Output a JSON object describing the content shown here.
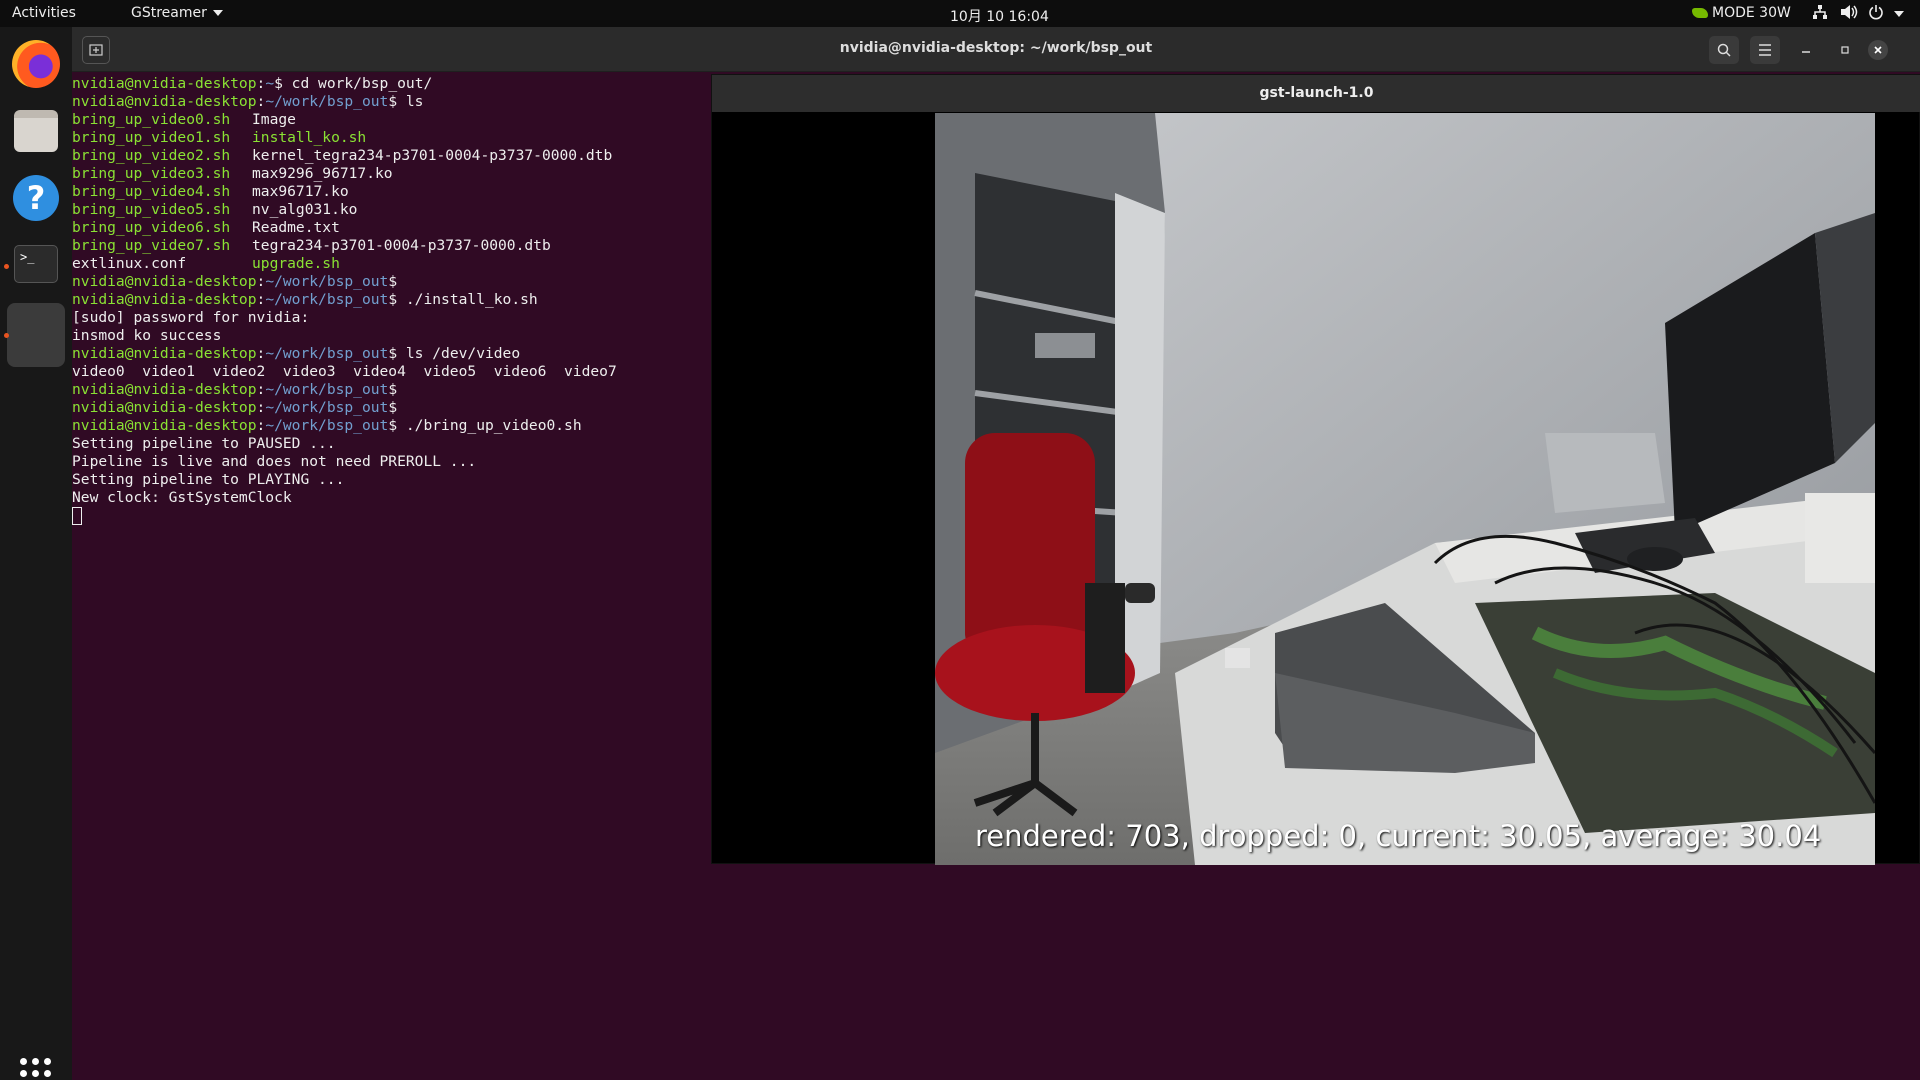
{
  "topbar": {
    "activities": "Activities",
    "app_menu": "GStreamer",
    "clock": "10月 10  16:04",
    "mode": "MODE 30W",
    "network_icon": "network-icon",
    "volume_icon": "volume-icon",
    "power_icon": "power-icon"
  },
  "dock": {
    "items": [
      "firefox",
      "files",
      "help",
      "terminal",
      "gst-launch"
    ],
    "show_apps_icon": "grid-icon"
  },
  "terminal": {
    "title": "nvidia@nvidia-desktop: ~/work/bsp_out",
    "lines": [
      {
        "user": "nvidia@nvidia-desktop",
        "path": "~",
        "cmd": "$ cd work/bsp_out/"
      },
      {
        "user": "nvidia@nvidia-desktop",
        "path": "~/work/bsp_out",
        "cmd": "$ ls"
      },
      {
        "col1": "bring_up_video0.sh",
        "col2": "Image",
        "col2green": false
      },
      {
        "col1": "bring_up_video1.sh",
        "col2": "install_ko.sh",
        "col2green": true
      },
      {
        "col1": "bring_up_video2.sh",
        "col2": "kernel_tegra234-p3701-0004-p3737-0000.dtb",
        "col2green": false
      },
      {
        "col1": "bring_up_video3.sh",
        "col2": "max9296_96717.ko",
        "col2green": false
      },
      {
        "col1": "bring_up_video4.sh",
        "col2": "max96717.ko",
        "col2green": false
      },
      {
        "col1": "bring_up_video5.sh",
        "col2": "nv_alg031.ko",
        "col2green": false
      },
      {
        "col1": "bring_up_video6.sh",
        "col2": "Readme.txt",
        "col2green": false
      },
      {
        "col1": "bring_up_video7.sh",
        "col2": "tegra234-p3701-0004-p3737-0000.dtb",
        "col2green": false
      },
      {
        "col1plain": "extlinux.conf",
        "col2": "upgrade.sh",
        "col2green": true
      },
      {
        "user": "nvidia@nvidia-desktop",
        "path": "~/work/bsp_out",
        "cmd": "$"
      },
      {
        "user": "nvidia@nvidia-desktop",
        "path": "~/work/bsp_out",
        "cmd": "$ ./install_ko.sh"
      },
      {
        "text": "[sudo] password for nvidia:"
      },
      {
        "text": "insmod ko success"
      },
      {
        "user": "nvidia@nvidia-desktop",
        "path": "~/work/bsp_out",
        "cmd": "$ ls /dev/video"
      },
      {
        "text": "video0  video1  video2  video3  video4  video5  video6  video7"
      },
      {
        "user": "nvidia@nvidia-desktop",
        "path": "~/work/bsp_out",
        "cmd": "$"
      },
      {
        "user": "nvidia@nvidia-desktop",
        "path": "~/work/bsp_out",
        "cmd": "$"
      },
      {
        "user": "nvidia@nvidia-desktop",
        "path": "~/work/bsp_out",
        "cmd": "$ ./bring_up_video0.sh"
      },
      {
        "text": "Setting pipeline to PAUSED ..."
      },
      {
        "text": "Pipeline is live and does not need PREROLL ..."
      },
      {
        "text": "Setting pipeline to PLAYING ..."
      },
      {
        "text": "New clock: GstSystemClock"
      }
    ]
  },
  "gst_window": {
    "title": "gst-launch-1.0",
    "overlay": "rendered: 703, dropped: 0, current: 30.05, average: 30.04"
  }
}
